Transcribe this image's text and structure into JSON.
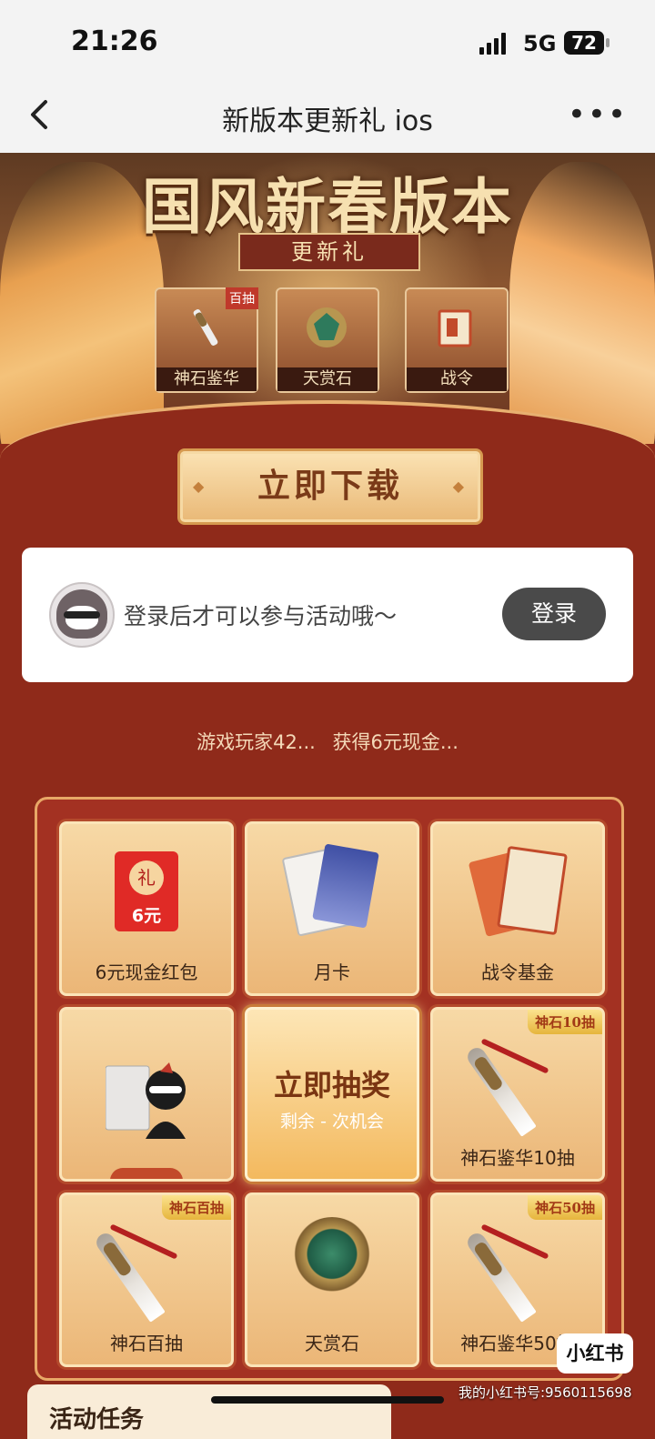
{
  "status": {
    "time": "21:26",
    "network": "5G",
    "battery": "72"
  },
  "nav": {
    "title": "新版本更新礼 ios",
    "more": "•••"
  },
  "banner": {
    "title": "国风新春版本",
    "subtitle": "更新礼",
    "items": [
      {
        "label": "神石鉴华",
        "tag": "百抽"
      },
      {
        "label": "天赏石",
        "tag": ""
      },
      {
        "label": "战令",
        "tag": ""
      }
    ]
  },
  "download_label": "立即下载",
  "login": {
    "prompt": "登录后才可以参与活动哦～",
    "button": "登录"
  },
  "ticker": {
    "user": "游戏玩家42...",
    "prize": "获得6元现金..."
  },
  "prizes": [
    {
      "label": "6元现金红包",
      "tag": "",
      "packet_char": "礼",
      "packet_value": "6元"
    },
    {
      "label": "月卡",
      "tag": ""
    },
    {
      "label": "战令基金",
      "tag": ""
    },
    {
      "label": "",
      "tag": ""
    },
    {
      "label": "神石鉴华10抽",
      "tag": "神石10抽"
    },
    {
      "label": "神石百抽",
      "tag": "神石百抽"
    },
    {
      "label": "天赏石",
      "tag": ""
    },
    {
      "label": "神石鉴华50抽",
      "tag": "神石50抽"
    }
  ],
  "draw": {
    "title": "立即抽奖",
    "remaining": "剩余 - 次机会"
  },
  "tasks_title": "活动任务",
  "watermark": {
    "brand": "小红书",
    "id": "我的小红书号:9560115698"
  },
  "colors": {
    "page_bg": "#8f2a1a",
    "accent": "#e8b070",
    "login_button": "#4a4a4a"
  }
}
